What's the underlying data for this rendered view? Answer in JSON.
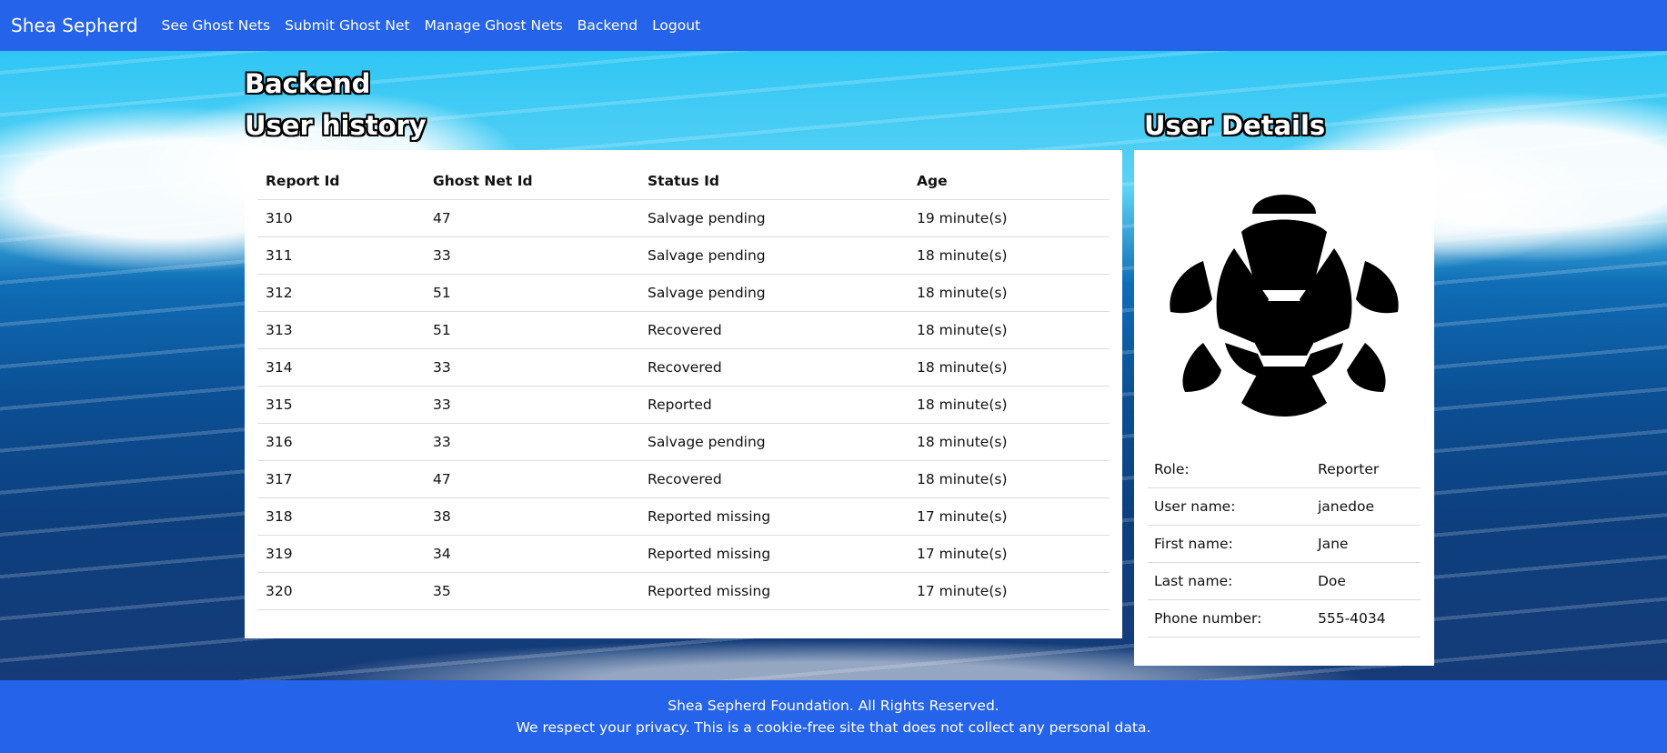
{
  "brand": "Shea Sepherd",
  "nav": {
    "items": [
      "See Ghost Nets",
      "Submit Ghost Net",
      "Manage Ghost Nets",
      "Backend",
      "Logout"
    ]
  },
  "page": {
    "title": "Backend",
    "history_title": "User history",
    "details_title": "User Details"
  },
  "history": {
    "columns": [
      "Report Id",
      "Ghost Net Id",
      "Status Id",
      "Age"
    ],
    "rows": [
      [
        "310",
        "47",
        "Salvage pending",
        "19 minute(s)"
      ],
      [
        "311",
        "33",
        "Salvage pending",
        "18 minute(s)"
      ],
      [
        "312",
        "51",
        "Salvage pending",
        "18 minute(s)"
      ],
      [
        "313",
        "51",
        "Recovered",
        "18 minute(s)"
      ],
      [
        "314",
        "33",
        "Recovered",
        "18 minute(s)"
      ],
      [
        "315",
        "33",
        "Reported",
        "18 minute(s)"
      ],
      [
        "316",
        "33",
        "Salvage pending",
        "18 minute(s)"
      ],
      [
        "317",
        "47",
        "Recovered",
        "18 minute(s)"
      ],
      [
        "318",
        "38",
        "Reported missing",
        "17 minute(s)"
      ],
      [
        "319",
        "34",
        "Reported missing",
        "17 minute(s)"
      ],
      [
        "320",
        "35",
        "Reported missing",
        "17 minute(s)"
      ]
    ]
  },
  "details": {
    "avatar_icon": "turtle-icon",
    "rows": [
      [
        "Role:",
        "Reporter"
      ],
      [
        "User name:",
        "janedoe"
      ],
      [
        "First name:",
        "Jane"
      ],
      [
        "Last name:",
        "Doe"
      ],
      [
        "Phone number:",
        "555-4034"
      ]
    ]
  },
  "footer": {
    "line1": "Shea Sepherd Foundation. All Rights Reserved.",
    "line2": "We respect your privacy. This is a cookie-free site that does not collect any personal data."
  },
  "colors": {
    "navbar": "#2563eb",
    "footer": "#2563eb",
    "panel": "#ffffff"
  }
}
